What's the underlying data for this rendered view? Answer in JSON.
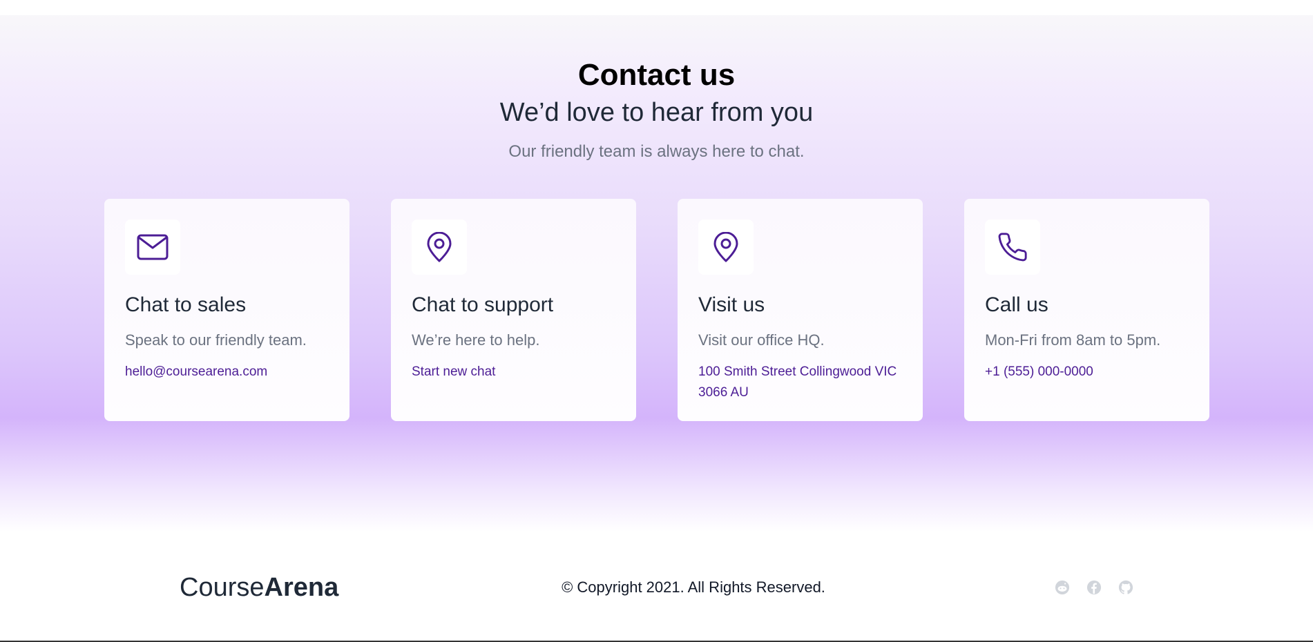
{
  "header": {
    "title": "Contact us",
    "subtitle": "We’d love to hear from you",
    "tagline": "Our friendly team is always here to chat."
  },
  "cards": [
    {
      "icon": "mail-icon",
      "title": "Chat to sales",
      "description": "Speak to our friendly team.",
      "link": "hello@coursearena.com"
    },
    {
      "icon": "map-pin-icon",
      "title": "Chat to support",
      "description": "We’re here to help.",
      "link": "Start new chat"
    },
    {
      "icon": "map-pin-icon",
      "title": "Visit us",
      "description": "Visit our office HQ.",
      "link": "100 Smith Street Collingwood VIC 3066 AU"
    },
    {
      "icon": "phone-icon",
      "title": "Call us",
      "description": "Mon-Fri from 8am to 5pm.",
      "link": "+1 (555) 000-0000"
    }
  ],
  "footer": {
    "logo_part1": "Course",
    "logo_part2": "Arena",
    "copyright": "© Copyright 2021. All Rights Reserved.",
    "social_icons": [
      "reddit-icon",
      "facebook-icon",
      "github-icon"
    ]
  },
  "colors": {
    "accent": "#4c1d95",
    "gradient_purple": "#d4b4fb",
    "heading": "#000000",
    "muted_text": "#6b7280",
    "social_icon": "#d1d5db"
  }
}
